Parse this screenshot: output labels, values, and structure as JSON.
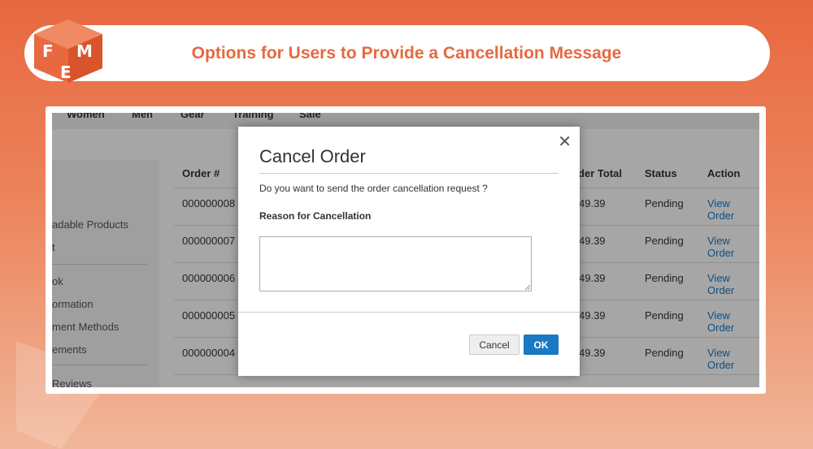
{
  "banner": {
    "title": "Options for Users to Provide a Cancellation Message"
  },
  "brand": {
    "logo_icon": "fme-cube-logo-icon",
    "primary": "#e8683f",
    "link": "#1979c3"
  },
  "store": {
    "nav": [
      "Women",
      "Men",
      "Gear",
      "Training",
      "Sale"
    ],
    "sidebar": [
      "adable Products",
      "t",
      "ok",
      "ormation",
      "ment Methods",
      "ements",
      "Reviews"
    ],
    "table": {
      "headers": [
        "Order #",
        "rder Total",
        "Status",
        "Action"
      ],
      "rows": [
        {
          "order": "000000008",
          "total": "49.39",
          "status": "Pending",
          "action": "View Order"
        },
        {
          "order": "000000007",
          "total": "49.39",
          "status": "Pending",
          "action": "View Order"
        },
        {
          "order": "000000006",
          "total": "49.39",
          "status": "Pending",
          "action": "View Order"
        },
        {
          "order": "000000005",
          "total": "49.39",
          "status": "Pending",
          "action": "View Order"
        },
        {
          "order": "000000004",
          "total": "49.39",
          "status": "Pending",
          "action": "View Order"
        }
      ]
    }
  },
  "modal": {
    "title": "Cancel Order",
    "close_icon": "close-icon",
    "question": "Do you want to send the order cancellation request ?",
    "reason_label": "Reason for Cancellation",
    "reason_value": "",
    "cancel_label": "Cancel",
    "ok_label": "OK"
  }
}
